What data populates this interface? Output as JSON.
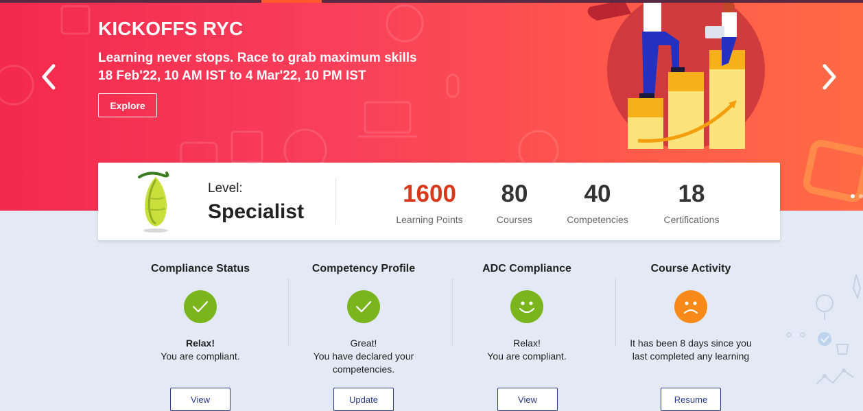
{
  "hero": {
    "title": "KICKOFFS RYC",
    "subtitle": "Learning never stops. Race to grab maximum skills",
    "dates": "18 Feb'22, 10 AM IST to 4 Mar'22, 10 PM IST",
    "explore_label": "Explore",
    "prev_icon": "chevron-left-icon",
    "next_icon": "chevron-right-icon"
  },
  "level": {
    "label": "Level:",
    "value": "Specialist",
    "badge_icon": "cocoon-icon"
  },
  "stats": [
    {
      "value": "1600",
      "label": "Learning Points"
    },
    {
      "value": "80",
      "label": "Courses"
    },
    {
      "value": "40",
      "label": "Competencies"
    },
    {
      "value": "18",
      "label": "Certifications"
    }
  ],
  "status_columns": [
    {
      "title": "Compliance Status",
      "icon": "check-icon",
      "status_line": "Relax!",
      "message": "You are compliant.",
      "button_label": "View",
      "color": "#7ab51d"
    },
    {
      "title": "Competency Profile",
      "icon": "check-icon",
      "status_line": "Great!",
      "message": "You have declared your competencies.",
      "button_label": "Update",
      "color": "#7ab51d"
    },
    {
      "title": "ADC Compliance",
      "icon": "smiley-icon",
      "status_line": "Relax!",
      "message": "You are compliant.",
      "button_label": "View",
      "color": "#7ab51d"
    },
    {
      "title": "Course Activity",
      "icon": "sad-face-icon",
      "status_line": "",
      "message": "It has been 8 days since you last completed any learning",
      "button_label": "Resume",
      "color": "#f88a1a"
    }
  ],
  "colors": {
    "hero_start": "#f3294e",
    "hero_end": "#ff6a45",
    "accent_points": "#d8391b",
    "positive": "#7ab51d",
    "warning": "#f88a1a",
    "page_bg": "#e3eaf5"
  }
}
